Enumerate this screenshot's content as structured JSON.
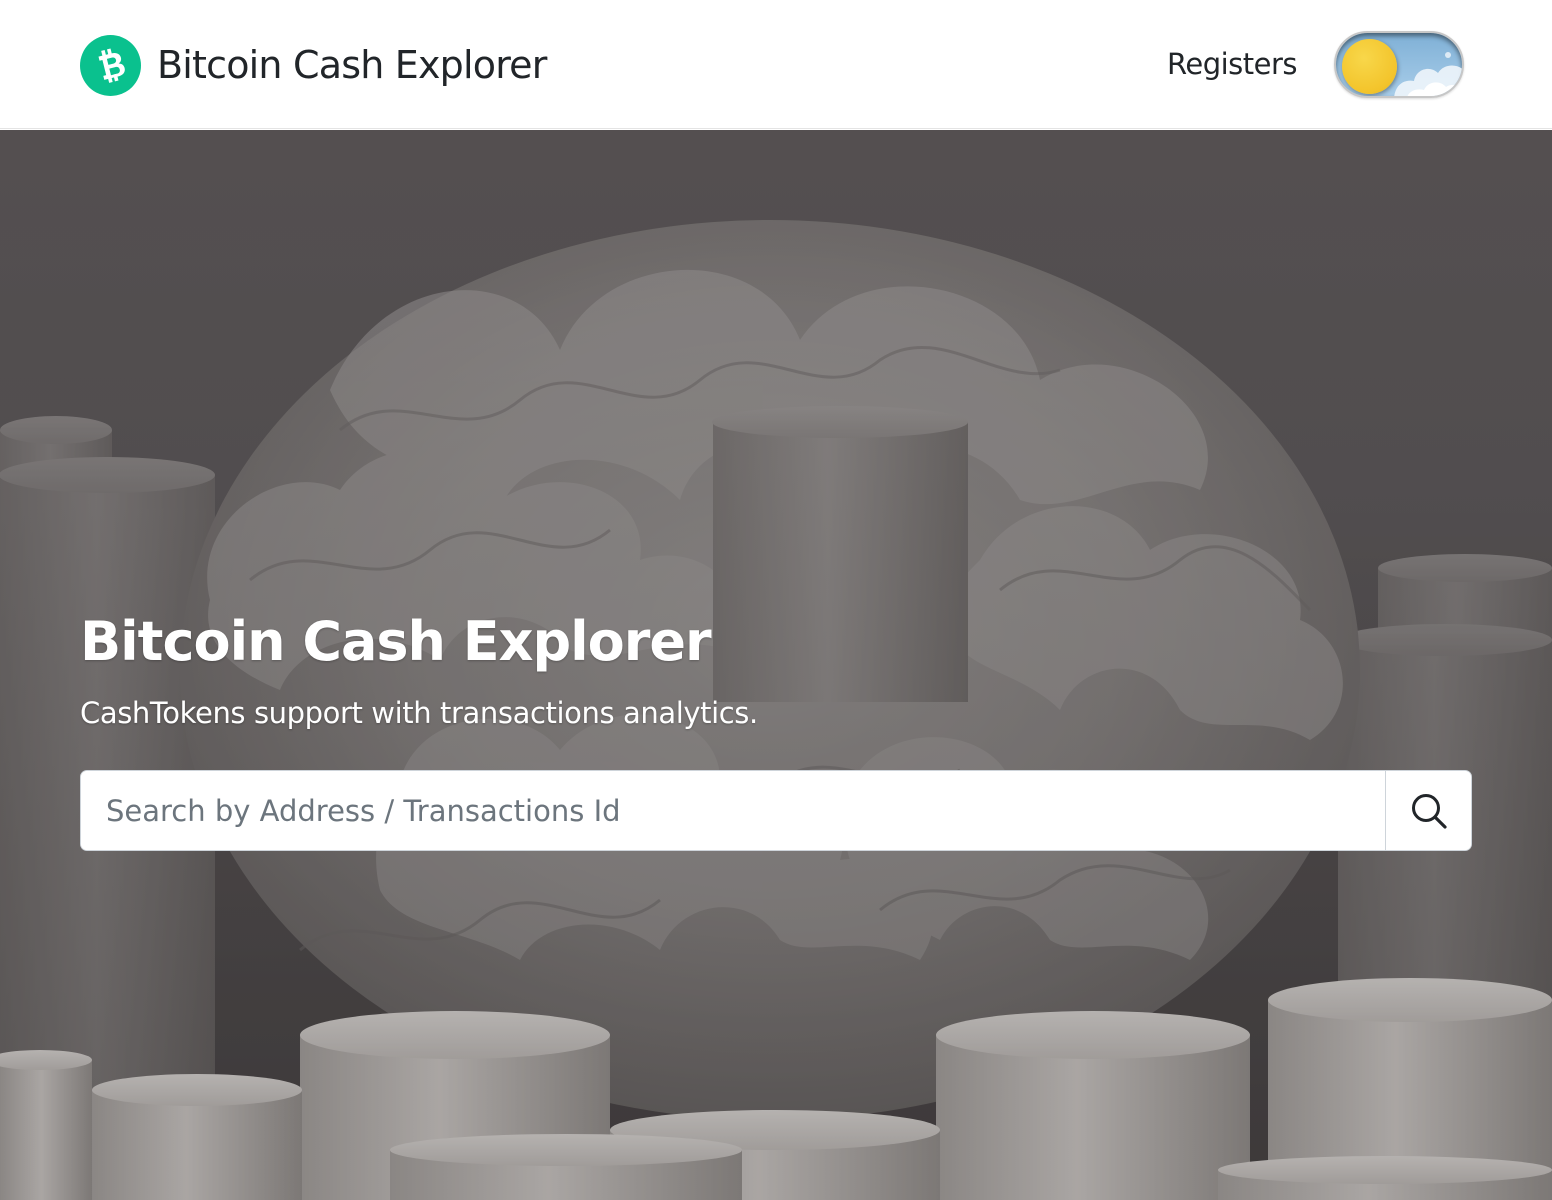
{
  "navbar": {
    "brand_name": "Bitcoin Cash Explorer",
    "logo_icon": "bitcoin-cash-logo-icon",
    "links": [
      {
        "label": "Registers"
      }
    ],
    "theme_toggle": {
      "state": "light",
      "knob_icon": "sun-icon"
    }
  },
  "hero": {
    "title": "Bitcoin Cash Explorer",
    "subtitle": "CashTokens support with transactions analytics.",
    "search": {
      "value": "",
      "placeholder": "Search by Address / Transactions Id",
      "button_icon": "search-icon"
    }
  },
  "colors": {
    "brand_green": "#0ac18e",
    "navbar_bg": "#ffffff",
    "hero_overlay": "#5f5b5c",
    "toggle_sky": "#8fbce0",
    "toggle_sun": "#f3c42b"
  }
}
